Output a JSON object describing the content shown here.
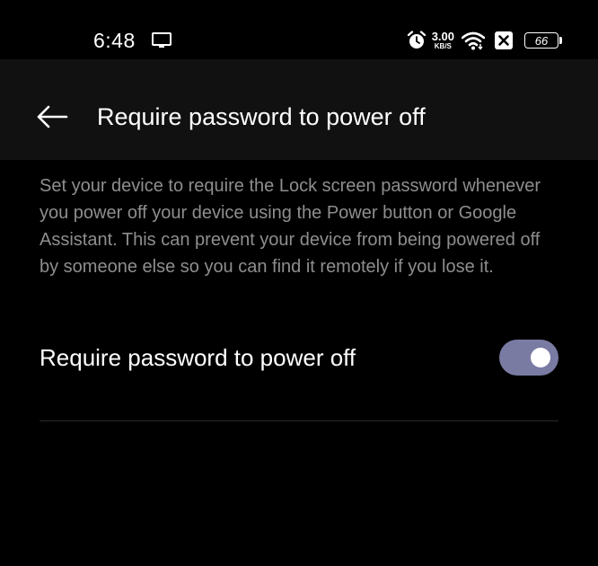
{
  "status_bar": {
    "time": "6:48",
    "net_speed_value": "3.00",
    "net_speed_unit": "KB/S",
    "battery_level": "66"
  },
  "app_bar": {
    "title": "Require password to power off"
  },
  "content": {
    "description": "Set your device to require the Lock screen password whenever you power off your device using the Power button or Google Assistant. This can prevent your device from being powered off by someone else so you can find it remotely if you lose it.",
    "setting_label": "Require password to power off",
    "setting_enabled": true
  },
  "colors": {
    "background": "#000000",
    "app_bar": "#111111",
    "toggle_on": "#7a7ba3",
    "description_text": "#8e8e8e"
  },
  "icons": {
    "back": "arrow-left-icon",
    "cast": "cast-icon",
    "alarm": "alarm-icon",
    "wifi": "wifi-icon",
    "notification": "x-box-icon",
    "battery": "battery-icon"
  }
}
